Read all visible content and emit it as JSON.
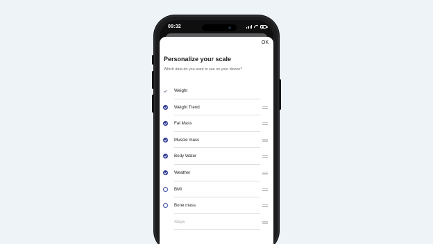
{
  "status_bar": {
    "time": "09:32"
  },
  "header": {
    "ok_label": "OK"
  },
  "title": "Personalize your scale",
  "subtitle": "Which data do you want to see on your device?",
  "items": [
    {
      "label": "Weight",
      "state": "fixed"
    },
    {
      "label": "Weight Trend",
      "state": "checked"
    },
    {
      "label": "Fat Mass",
      "state": "checked"
    },
    {
      "label": "Muscle mass",
      "state": "checked"
    },
    {
      "label": "Body Water",
      "state": "checked"
    },
    {
      "label": "Weather",
      "state": "checked"
    },
    {
      "label": "BMI",
      "state": "unchecked"
    },
    {
      "label": "Bone mass",
      "state": "unchecked"
    },
    {
      "label": "Steps",
      "state": "disabled"
    }
  ],
  "colors": {
    "accent": "#2f3d92",
    "background": "#eef3f8"
  }
}
